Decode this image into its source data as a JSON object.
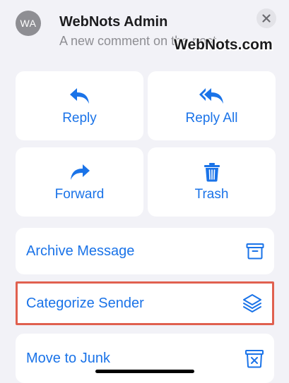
{
  "header": {
    "avatar_initials": "WA",
    "sender_name": "WebNots Admin",
    "preview_text": "A new comment on the post",
    "watermark": "WebNots.com",
    "close_icon": "close-icon"
  },
  "actions": [
    {
      "label": "Reply",
      "icon": "reply-icon"
    },
    {
      "label": "Reply All",
      "icon": "reply-all-icon"
    },
    {
      "label": "Forward",
      "icon": "forward-icon"
    },
    {
      "label": "Trash",
      "icon": "trash-icon"
    }
  ],
  "menu": [
    {
      "label": "Archive Message",
      "icon": "archive-box-icon"
    },
    {
      "label": "Categorize Sender",
      "icon": "layers-icon",
      "highlighted": true
    },
    {
      "label": "Move to Junk",
      "icon": "junk-bin-icon"
    }
  ],
  "colors": {
    "accent": "#1a73e8",
    "highlight_border": "#e0604f",
    "background": "#f2f2f7"
  }
}
